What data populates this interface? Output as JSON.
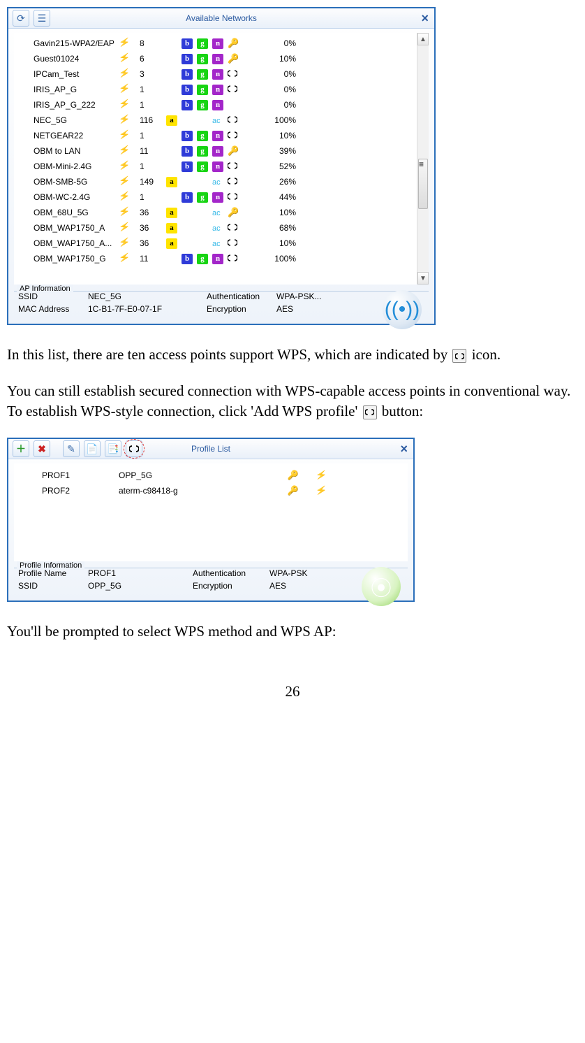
{
  "page_number": "26",
  "paragraphs": {
    "p1a": "In this list, there are ten access points support WPS, which are indicated by ",
    "p1b": " icon.",
    "p2a": "You can still establish secured connection with WPS-capable access points in conventional way. To establish WPS-style connection, click 'Add WPS profile' ",
    "p2b": " button:",
    "p3": "You'll be prompted to select WPS method and WPS AP:"
  },
  "available_networks": {
    "title": "Available Networks",
    "scrollbar_present": true,
    "ap_info_title": "AP Information",
    "ap_info": {
      "ssid_label": "SSID",
      "ssid": "NEC_5G",
      "auth_label": "Authentication",
      "auth": "WPA-PSK...",
      "mac_label": "MAC Address",
      "mac": "1C-B1-7F-E0-07-1F",
      "enc_label": "Encryption",
      "enc": "AES"
    },
    "rows": [
      {
        "ssid": "Gavin215-WPA2/EAP",
        "ch": "8",
        "a": false,
        "b": true,
        "g": true,
        "n": true,
        "ac": false,
        "sec": "key",
        "signal": "0%"
      },
      {
        "ssid": "Guest01024",
        "ch": "6",
        "a": false,
        "b": true,
        "g": true,
        "n": true,
        "ac": false,
        "sec": "key",
        "signal": "10%"
      },
      {
        "ssid": "IPCam_Test",
        "ch": "3",
        "a": false,
        "b": true,
        "g": true,
        "n": true,
        "ac": false,
        "sec": "wps",
        "signal": "0%"
      },
      {
        "ssid": "IRIS_AP_G",
        "ch": "1",
        "a": false,
        "b": true,
        "g": true,
        "n": true,
        "ac": false,
        "sec": "wps",
        "signal": "0%"
      },
      {
        "ssid": "IRIS_AP_G_222",
        "ch": "1",
        "a": false,
        "b": true,
        "g": true,
        "n": true,
        "ac": false,
        "sec": "",
        "signal": "0%"
      },
      {
        "ssid": "NEC_5G",
        "ch": "116",
        "a": true,
        "b": false,
        "g": false,
        "n": false,
        "ac": true,
        "sec": "wps",
        "signal": "100%"
      },
      {
        "ssid": "NETGEAR22",
        "ch": "1",
        "a": false,
        "b": true,
        "g": true,
        "n": true,
        "ac": false,
        "sec": "wps",
        "signal": "10%"
      },
      {
        "ssid": "OBM to LAN",
        "ch": "11",
        "a": false,
        "b": true,
        "g": true,
        "n": true,
        "ac": false,
        "sec": "key",
        "signal": "39%"
      },
      {
        "ssid": "OBM-Mini-2.4G",
        "ch": "1",
        "a": false,
        "b": true,
        "g": true,
        "n": true,
        "ac": false,
        "sec": "wps",
        "signal": "52%"
      },
      {
        "ssid": "OBM-SMB-5G",
        "ch": "149",
        "a": true,
        "b": false,
        "g": false,
        "n": false,
        "ac": true,
        "sec": "wps",
        "signal": "26%"
      },
      {
        "ssid": "OBM-WC-2.4G",
        "ch": "1",
        "a": false,
        "b": true,
        "g": true,
        "n": true,
        "ac": false,
        "sec": "wps",
        "signal": "44%"
      },
      {
        "ssid": "OBM_68U_5G",
        "ch": "36",
        "a": true,
        "b": false,
        "g": false,
        "n": false,
        "ac": true,
        "sec": "key",
        "signal": "10%"
      },
      {
        "ssid": "OBM_WAP1750_A",
        "ch": "36",
        "a": true,
        "b": false,
        "g": false,
        "n": false,
        "ac": true,
        "sec": "wps",
        "signal": "68%"
      },
      {
        "ssid": "OBM_WAP1750_A...",
        "ch": "36",
        "a": true,
        "b": false,
        "g": false,
        "n": false,
        "ac": true,
        "sec": "wps",
        "signal": "10%"
      },
      {
        "ssid": "OBM_WAP1750_G",
        "ch": "11",
        "a": false,
        "b": true,
        "g": true,
        "n": true,
        "ac": false,
        "sec": "wps",
        "signal": "100%"
      }
    ]
  },
  "profile_list": {
    "title": "Profile List",
    "info_title": "Profile Information",
    "rows": [
      {
        "name": "PROF1",
        "ssid": "OPP_5G"
      },
      {
        "name": "PROF2",
        "ssid": "aterm-c98418-g"
      }
    ],
    "info": {
      "pname_label": "Profile Name",
      "pname": "PROF1",
      "auth_label": "Authentication",
      "auth": "WPA-PSK",
      "ssid_label": "SSID",
      "ssid": "OPP_5G",
      "enc_label": "Encryption",
      "enc": "AES"
    }
  }
}
